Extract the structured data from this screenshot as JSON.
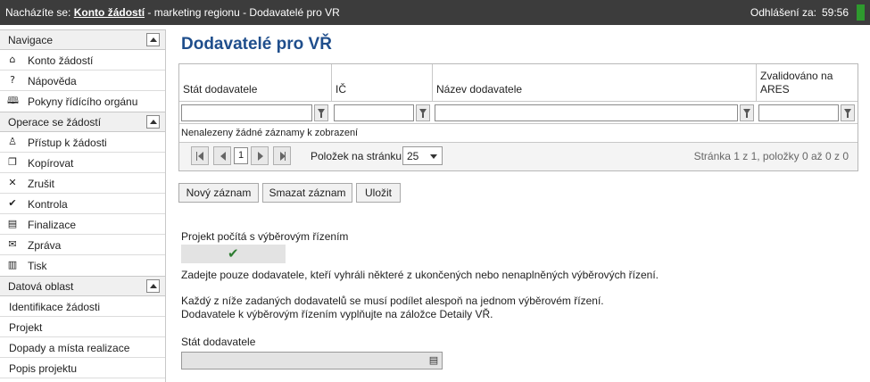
{
  "topbar": {
    "prefix": "Nacházíte se: ",
    "link": "Konto žádostí",
    "rest": " - marketing regionu - Dodavatelé pro VR",
    "logout_label": "Odhlášení za:",
    "logout_time": "59:56",
    "status_color": "#2e9a2e"
  },
  "sidebar": {
    "nav_header": "Navigace",
    "nav_items": [
      {
        "label": "Konto žádostí",
        "icon": "home-icon",
        "glyph": "⌂"
      },
      {
        "label": "Nápověda",
        "icon": "help-icon",
        "glyph": "?"
      },
      {
        "label": "Pokyny řídícího orgánu",
        "icon": "book-icon",
        "glyph": "🕮"
      }
    ],
    "ops_header": "Operace se žádostí",
    "ops_items": [
      {
        "label": "Přístup k žádosti",
        "icon": "user-icon",
        "glyph": "♙"
      },
      {
        "label": "Kopírovat",
        "icon": "copy-icon",
        "glyph": "❐"
      },
      {
        "label": "Zrušit",
        "icon": "cross-icon",
        "glyph": "✕"
      },
      {
        "label": "Kontrola",
        "icon": "check-icon",
        "glyph": "✔"
      },
      {
        "label": "Finalizace",
        "icon": "finalize-icon",
        "glyph": "▤"
      },
      {
        "label": "Zpráva",
        "icon": "message-icon",
        "glyph": "✉"
      },
      {
        "label": "Tisk",
        "icon": "print-icon",
        "glyph": "▥"
      }
    ],
    "data_header": "Datová oblast",
    "data_items": [
      {
        "label": "Identifikace žádosti"
      },
      {
        "label": "Projekt"
      },
      {
        "label": "Dopady a místa realizace"
      },
      {
        "label": "Popis projektu"
      }
    ]
  },
  "main": {
    "title": "Dodavatelé pro VŘ",
    "grid": {
      "columns": [
        "Stát dodavatele",
        "IČ",
        "Název dodavatele",
        "Zvalidováno na ARES"
      ],
      "empty_message": "Nenalezeny žádné záznamy k zobrazení",
      "pager": {
        "current_page": "1",
        "page_size_label": "Položek na stránku",
        "page_size": "25",
        "info": "Stránka 1 z 1, položky 0 až 0 z 0"
      }
    },
    "buttons": {
      "new": "Nový záznam",
      "delete": "Smazat záznam",
      "save": "Uložit"
    },
    "form": {
      "tender_label": "Projekt počítá s výběrovým řízením",
      "tender_checked": "✔",
      "info_1": "Zadejte pouze dodavatele, kteří vyhráli některé z ukončených nebo nenaplněných výběrových řízení.",
      "info_2": "Každý z níže zadaných dodavatelů se musí podílet alespoň na jednom výběrovém řízení.",
      "info_3": "Dodavatele k výběrovým řízením vyplňujte na záložce Detaily VŘ.",
      "country_label": "Stát dodavatele",
      "country_value": ""
    },
    "colors": {
      "title": "#1f4e8c",
      "topbar_bg": "#3c3c3c"
    }
  }
}
